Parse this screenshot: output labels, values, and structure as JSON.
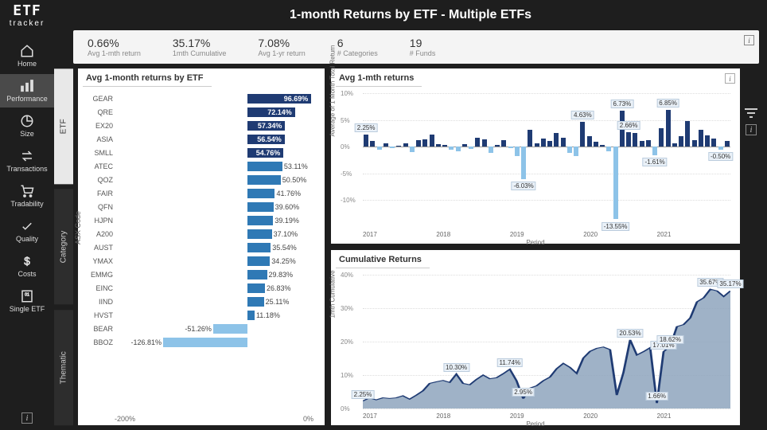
{
  "brand": {
    "name": "ETF",
    "sub": "tracker"
  },
  "title": "1-month Returns by ETF - Multiple ETFs",
  "nav": [
    {
      "id": "home",
      "label": "Home"
    },
    {
      "id": "performance",
      "label": "Performance"
    },
    {
      "id": "size",
      "label": "Size"
    },
    {
      "id": "transactions",
      "label": "Transactions"
    },
    {
      "id": "tradability",
      "label": "Tradability"
    },
    {
      "id": "quality",
      "label": "Quality"
    },
    {
      "id": "costs",
      "label": "Costs"
    },
    {
      "id": "single",
      "label": "Single ETF"
    }
  ],
  "kpi": [
    {
      "value": "0.66%",
      "label": "Avg 1-mth return"
    },
    {
      "value": "35.17%",
      "label": "1mth Cumulative"
    },
    {
      "value": "7.08%",
      "label": "Avg 1-yr return"
    },
    {
      "value": "6",
      "label": "# Categories"
    },
    {
      "value": "19",
      "label": "# Funds"
    }
  ],
  "vtabs": [
    "ETF",
    "Category",
    "Thematic"
  ],
  "panelTitles": {
    "bar": "Avg 1-month returns by ETF",
    "col": "Avg 1-mth returns",
    "area": "Cumulative Returns"
  },
  "axisLabels": {
    "bar_y": "ASX Code",
    "col_y": "Average of 1 Month Total Return",
    "col_x": "Period",
    "area_y": "1mth Cumulative",
    "area_x": "Period"
  },
  "chart_data": [
    {
      "type": "bar",
      "title": "Avg 1-month returns by ETF",
      "ylabel": "ASX Code",
      "xlabel": "",
      "xlim": [
        -200,
        100
      ],
      "xticks": [
        "-200%",
        "0%"
      ],
      "palette": {
        "dark": "#1f3b73",
        "mid": "#2f79b5",
        "light": "#8dc3e8"
      },
      "categories": [
        "GEAR",
        "QRE",
        "EX20",
        "ASIA",
        "SMLL",
        "ATEC",
        "QOZ",
        "FAIR",
        "QFN",
        "HJPN",
        "A200",
        "AUST",
        "YMAX",
        "EMMG",
        "EINC",
        "IIND",
        "HVST",
        "BEAR",
        "BBOZ"
      ],
      "values": [
        96.69,
        72.14,
        57.34,
        56.54,
        54.76,
        53.11,
        50.5,
        41.76,
        39.6,
        39.19,
        37.1,
        35.54,
        34.25,
        29.83,
        26.83,
        25.11,
        11.18,
        -51.26,
        -126.81
      ],
      "label_inside": [
        true,
        true,
        true,
        true,
        true,
        false,
        false,
        false,
        false,
        false,
        false,
        false,
        false,
        false,
        false,
        false,
        false,
        false,
        false
      ],
      "color": [
        "dark",
        "dark",
        "dark",
        "dark",
        "dark",
        "mid",
        "mid",
        "mid",
        "mid",
        "mid",
        "mid",
        "mid",
        "mid",
        "mid",
        "mid",
        "mid",
        "mid",
        "light",
        "light"
      ]
    },
    {
      "type": "bar_vertical",
      "title": "Avg 1-mth returns",
      "xlabel": "Period",
      "ylabel": "Average of 1 Month Total Return",
      "ylim": [
        -15,
        10
      ],
      "yticks": [
        "10%",
        "5%",
        "0%",
        "-5%",
        "-10%"
      ],
      "x_major": [
        "2017",
        "2018",
        "2019",
        "2020",
        "2021"
      ],
      "values": [
        2.25,
        1.0,
        -0.6,
        0.6,
        -0.2,
        0.2,
        0.6,
        -1.0,
        1.2,
        1.3,
        2.2,
        0.5,
        0.4,
        -0.6,
        -0.8,
        0.5,
        -0.4,
        1.6,
        1.3,
        -1.1,
        0.3,
        1.2,
        -0.3,
        -1.8,
        -6.03,
        3.2,
        0.7,
        1.5,
        1.1,
        2.5,
        1.6,
        -1.2,
        -1.8,
        4.63,
        2.0,
        0.9,
        0.4,
        -0.8,
        -13.55,
        6.73,
        2.66,
        2.5,
        1.0,
        1.2,
        -1.61,
        3.4,
        6.85,
        0.6,
        2.0,
        4.8,
        1.2,
        3.2,
        2.1,
        1.5,
        -0.5,
        1.0
      ],
      "annotations": [
        {
          "index": 0,
          "text": "2.25%",
          "pos": "above"
        },
        {
          "index": 24,
          "text": "-6.03%",
          "pos": "below"
        },
        {
          "index": 33,
          "text": "4.63%",
          "pos": "above"
        },
        {
          "index": 38,
          "text": "-13.55%",
          "pos": "below"
        },
        {
          "index": 39,
          "text": "6.73%",
          "pos": "above"
        },
        {
          "index": 40,
          "text": "2.66%",
          "pos": "above"
        },
        {
          "index": 44,
          "text": "-1.61%",
          "pos": "below"
        },
        {
          "index": 46,
          "text": "6.85%",
          "pos": "above"
        },
        {
          "index": 54,
          "text": "-0.50%",
          "pos": "below"
        }
      ]
    },
    {
      "type": "area",
      "title": "Cumulative Returns",
      "xlabel": "Period",
      "ylabel": "1mth Cumulative",
      "ylim": [
        0,
        40
      ],
      "yticks": [
        "40%",
        "30%",
        "20%",
        "10%",
        "0%"
      ],
      "x_major": [
        "2017",
        "2018",
        "2019",
        "2020",
        "2021"
      ],
      "values": [
        2.25,
        3.2,
        2.6,
        3.2,
        3.0,
        3.2,
        3.8,
        2.8,
        4.0,
        5.3,
        7.5,
        8.0,
        8.4,
        7.8,
        10.3,
        7.5,
        7.1,
        8.7,
        10.0,
        8.9,
        9.2,
        10.4,
        11.74,
        8.3,
        2.95,
        6.1,
        6.8,
        8.3,
        9.4,
        11.9,
        13.5,
        12.3,
        10.5,
        15.1,
        17.1,
        18.0,
        18.4,
        17.6,
        4.0,
        10.8,
        20.53,
        16.0,
        17.0,
        18.2,
        1.6,
        17.01,
        18.62,
        24.5,
        25.1,
        27.1,
        31.9,
        33.1,
        35.67,
        35.17,
        33.5,
        35.17
      ],
      "annotations": [
        {
          "index": 0,
          "text": "2.25%"
        },
        {
          "index": 14,
          "text": "10.30%"
        },
        {
          "index": 22,
          "text": "11.74%"
        },
        {
          "index": 24,
          "text": "2.95%"
        },
        {
          "index": 40,
          "text": "20.53%"
        },
        {
          "index": 44,
          "text": "1.66%"
        },
        {
          "index": 45,
          "text": "17.01%"
        },
        {
          "index": 46,
          "text": "18.62%"
        },
        {
          "index": 52,
          "text": "35.67%"
        },
        {
          "index": 55,
          "text": "35.17%"
        }
      ]
    }
  ]
}
